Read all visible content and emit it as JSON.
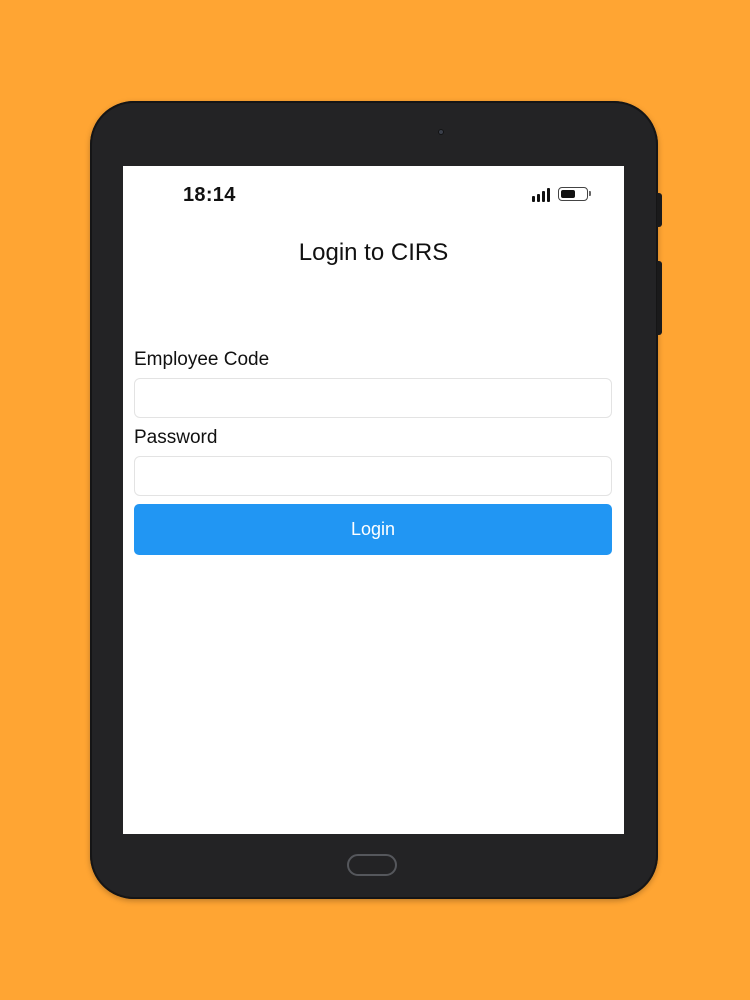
{
  "status_bar": {
    "time": "18:14",
    "battery_level": 0.6
  },
  "login": {
    "title": "Login to CIRS",
    "employee_code_label": "Employee Code",
    "employee_code_value": "",
    "password_label": "Password",
    "password_value": "",
    "login_button_label": "Login"
  },
  "colors": {
    "background": "#FFA533",
    "accent": "#2196F3",
    "device_frame": "#232325"
  },
  "icons": {
    "signal": "signal-icon",
    "battery": "battery-icon"
  }
}
